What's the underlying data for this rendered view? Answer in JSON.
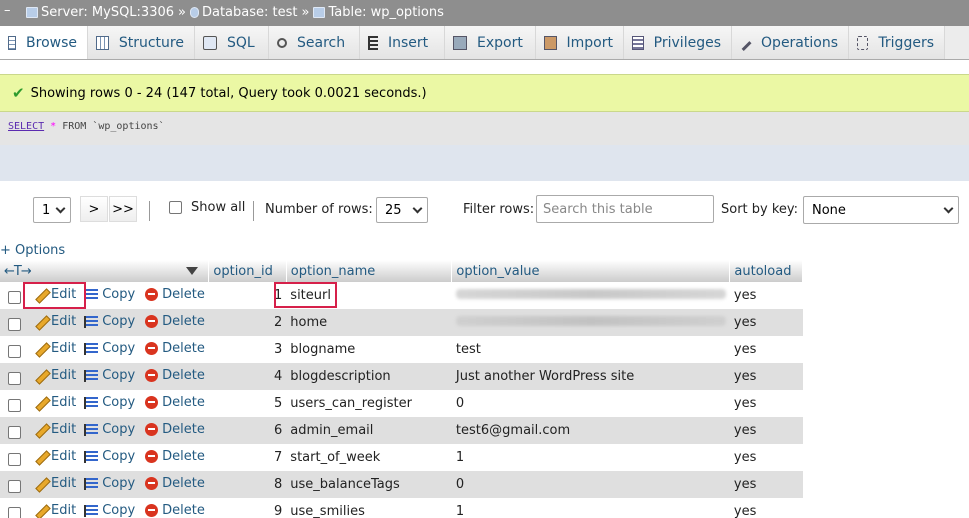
{
  "breadcrumb": {
    "server": "Server: MySQL:3306",
    "database": "Database: test",
    "table": "Table: wp_options",
    "sep": "»"
  },
  "tabs": [
    {
      "label": "Browse",
      "icon": "browse-icon",
      "active": true
    },
    {
      "label": "Structure",
      "icon": "structure-icon"
    },
    {
      "label": "SQL",
      "icon": "sql-icon"
    },
    {
      "label": "Search",
      "icon": "search-icon"
    },
    {
      "label": "Insert",
      "icon": "insert-icon"
    },
    {
      "label": "Export",
      "icon": "export-icon"
    },
    {
      "label": "Import",
      "icon": "import-icon"
    },
    {
      "label": "Privileges",
      "icon": "privileges-icon"
    },
    {
      "label": "Operations",
      "icon": "operations-icon"
    },
    {
      "label": "Triggers",
      "icon": "triggers-icon"
    }
  ],
  "message": "Showing rows 0 - 24 (147 total, Query took 0.0021 seconds.)",
  "sql": {
    "select": "SELECT",
    "star": "*",
    "rest": "FROM `wp_options`"
  },
  "nav": {
    "page": "1",
    "next": ">",
    "last": ">>",
    "show_all": "Show all",
    "rows_label": "Number of rows:",
    "rows_value": "25",
    "filter_label": "Filter rows:",
    "filter_placeholder": "Search this table",
    "sort_label": "Sort by key:",
    "sort_value": "None"
  },
  "options_link": "+ Options",
  "table": {
    "columns": [
      "option_id",
      "option_name",
      "option_value",
      "autoload"
    ],
    "actions": {
      "edit": "Edit",
      "copy": "Copy",
      "delete": "Delete"
    },
    "rows": [
      {
        "id": "1",
        "name": "siteurl",
        "value": "",
        "autoload": "yes",
        "value_blurred": true
      },
      {
        "id": "2",
        "name": "home",
        "value": "",
        "autoload": "yes",
        "value_blurred": true
      },
      {
        "id": "3",
        "name": "blogname",
        "value": "test",
        "autoload": "yes"
      },
      {
        "id": "4",
        "name": "blogdescription",
        "value": "Just another WordPress site",
        "autoload": "yes"
      },
      {
        "id": "5",
        "name": "users_can_register",
        "value": "0",
        "autoload": "yes"
      },
      {
        "id": "6",
        "name": "admin_email",
        "value": "test6@gmail.com",
        "autoload": "yes"
      },
      {
        "id": "7",
        "name": "start_of_week",
        "value": "1",
        "autoload": "yes"
      },
      {
        "id": "8",
        "name": "use_balanceTags",
        "value": "0",
        "autoload": "yes"
      },
      {
        "id": "9",
        "name": "use_smilies",
        "value": "1",
        "autoload": "yes"
      }
    ]
  },
  "colors": {
    "link": "#235a81",
    "success_bg": "#ebf8a4",
    "highlight": "#d6204a",
    "delete": "#d9341f"
  }
}
